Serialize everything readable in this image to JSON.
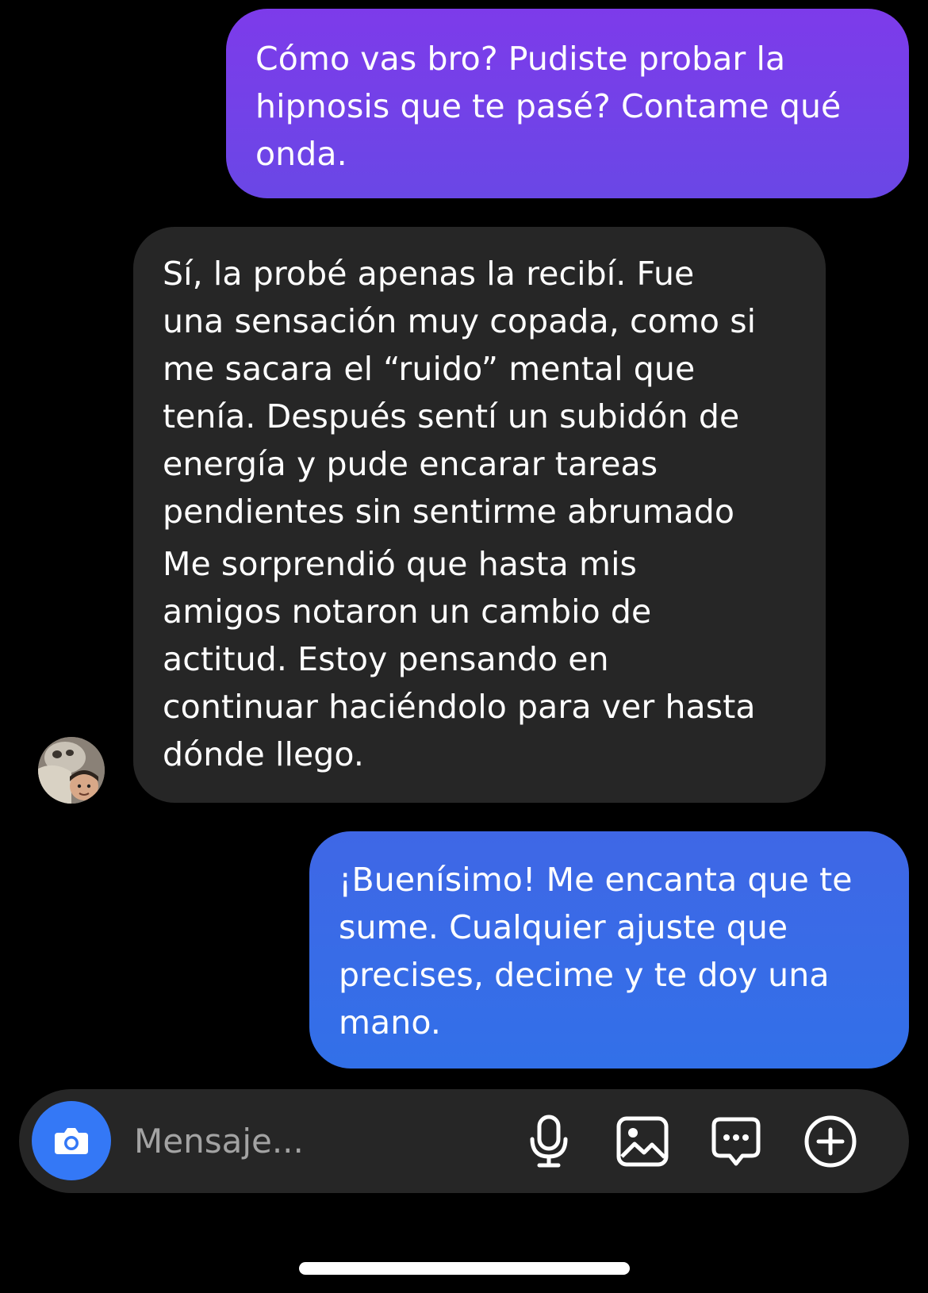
{
  "conversation": {
    "messages": [
      {
        "direction": "outgoing",
        "lines": [
          "Cómo vas bro? Pudiste probar la",
          "hipnosis que te pasé? Contame qué",
          "onda."
        ]
      },
      {
        "direction": "incoming",
        "paragraph1": [
          "Sí, la probé apenas la recibí. Fue",
          "una sensación muy copada, como si",
          "me sacara el “ruido” mental que",
          "tenía. Después sentí un subidón de",
          "energía y pude encarar tareas",
          "pendientes sin sentirme abrumado"
        ],
        "paragraph2": [
          "Me sorprendió que hasta mis",
          "amigos notaron un cambio de",
          "actitud. Estoy pensando en",
          "continuar haciéndolo para ver hasta",
          "dónde llego."
        ]
      },
      {
        "direction": "outgoing",
        "lines": [
          "¡Buenísimo! Me encanta que te",
          "sume. Cualquier ajuste que",
          "precises, decime y te doy una",
          "mano."
        ]
      }
    ]
  },
  "composer": {
    "placeholder": "Mensaje...",
    "icons": {
      "camera": "camera-icon",
      "mic": "microphone-icon",
      "gallery": "gallery-icon",
      "sticker": "sticker-icon",
      "plus": "add-icon"
    }
  },
  "colors": {
    "background": "#000000",
    "outgoing_top": "#7d3bea",
    "outgoing_bottom": "#3270e8",
    "incoming": "#262626",
    "camera_button": "#3478f6"
  }
}
